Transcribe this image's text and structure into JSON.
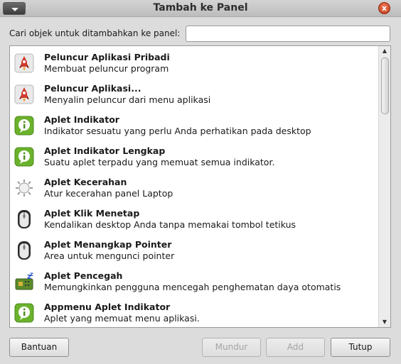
{
  "window": {
    "title": "Tambah ke Panel",
    "close_glyph": "x"
  },
  "search": {
    "label": "Cari objek untuk ditambahkan ke panel:",
    "value": "",
    "placeholder": ""
  },
  "items": [
    {
      "icon": "rocket-launcher-icon",
      "title": "Peluncur Aplikasi Pribadi",
      "desc": "Membuat peluncur program"
    },
    {
      "icon": "rocket-launcher-icon",
      "title": "Peluncur Aplikasi...",
      "desc": "Menyalin peluncur dari menu aplikasi"
    },
    {
      "icon": "info-indicator-icon",
      "title": "Aplet Indikator",
      "desc": "Indikator sesuatu yang perlu Anda perhatikan pada desktop"
    },
    {
      "icon": "info-indicator-icon",
      "title": "Aplet Indikator Lengkap",
      "desc": "Suatu aplet terpadu yang memuat semua indikator."
    },
    {
      "icon": "brightness-sun-icon",
      "title": "Aplet Kecerahan",
      "desc": "Atur kecerahan panel Laptop"
    },
    {
      "icon": "mouse-icon",
      "title": "Aplet Klik Menetap",
      "desc": "Kendalikan desktop Anda tanpa memakai tombol tetikus"
    },
    {
      "icon": "mouse-icon",
      "title": "Aplet Menangkap Pointer",
      "desc": "Area untuk mengunci pointer"
    },
    {
      "icon": "inhibit-sleep-icon",
      "title": "Aplet Pencegah",
      "desc": "Memungkinkan pengguna mencegah penghematan daya otomatis"
    },
    {
      "icon": "info-indicator-icon",
      "title": "Appmenu Aplet Indikator",
      "desc": "Aplet yang memuat menu aplikasi."
    }
  ],
  "scrollbar": {
    "up_glyph": "▲",
    "down_glyph": "▼"
  },
  "buttons": {
    "help": "Bantuan",
    "back": "Mundur",
    "add": "Add",
    "close": "Tutup"
  }
}
